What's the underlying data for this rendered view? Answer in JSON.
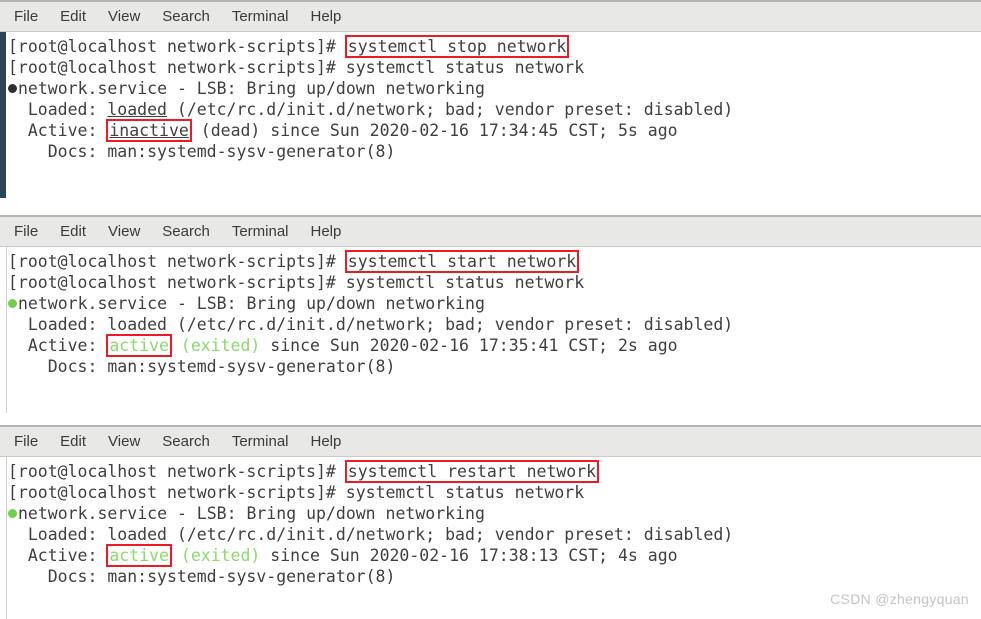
{
  "menu": {
    "items": [
      "File",
      "Edit",
      "View",
      "Search",
      "Terminal",
      "Help"
    ]
  },
  "colors": {
    "accent_red": "#ee1b24",
    "active_green": "#8ada6c",
    "dot_active_green": "#6ed24a",
    "dot_dead": "#2e2e2e",
    "menubar_bg": "#e8e8e6",
    "terminal_bg": "#ffffff",
    "text": "#3f3f3f",
    "left_edge_dark": "#2d4356",
    "watermark": "#c4c4c4"
  },
  "watermark": "CSDN @zhengyquan",
  "terminals": [
    {
      "id": "terminal-stop",
      "left_edge": "dark",
      "prompt": "[root@localhost network-scripts]# ",
      "command_highlighted": "systemctl stop network",
      "prompt2": "[root@localhost network-scripts]# ",
      "command2": "systemctl status network",
      "status_dot": "dead",
      "unit_line": "network.service - LSB: Bring up/down networking",
      "loaded_label": "  Loaded: ",
      "loaded_word": "loaded",
      "loaded_word_underlined": true,
      "loaded_rest": " (/etc/rc.d/init.d/network; bad; vendor preset: disabled)",
      "active_label": "  Active: ",
      "active_word": "inactive",
      "active_word_color": "dark",
      "active_word_underlined": true,
      "active_paren": " (dead)",
      "active_paren_color": "dark",
      "active_rest": " since Sun 2020-02-16 17:34:45 CST; 5s ago",
      "docs_line": "    Docs: man:systemd-sysv-generator(8)"
    },
    {
      "id": "terminal-start",
      "left_edge": "light",
      "prompt": "[root@localhost network-scripts]# ",
      "command_highlighted": "systemctl start network",
      "prompt2": "[root@localhost network-scripts]# ",
      "command2": "systemctl status network",
      "status_dot": "active",
      "unit_line": "network.service - LSB: Bring up/down networking",
      "loaded_label": "  Loaded: ",
      "loaded_word": "loaded",
      "loaded_word_underlined": false,
      "loaded_rest": " (/etc/rc.d/init.d/network; bad; vendor preset: disabled)",
      "active_label": "  Active: ",
      "active_word": "active",
      "active_word_color": "green",
      "active_word_underlined": false,
      "active_paren": " (exited)",
      "active_paren_color": "green",
      "active_rest": " since Sun 2020-02-16 17:35:41 CST; 2s ago",
      "docs_line": "    Docs: man:systemd-sysv-generator(8)"
    },
    {
      "id": "terminal-restart",
      "left_edge": "light",
      "prompt": "[root@localhost network-scripts]# ",
      "command_highlighted": "systemctl restart network",
      "prompt2": "[root@localhost network-scripts]# ",
      "command2": "systemctl status network",
      "status_dot": "active",
      "unit_line": "network.service - LSB: Bring up/down networking",
      "loaded_label": "  Loaded: ",
      "loaded_word": "loaded",
      "loaded_word_underlined": false,
      "loaded_rest": " (/etc/rc.d/init.d/network; bad; vendor preset: disabled)",
      "active_label": "  Active: ",
      "active_word": "active",
      "active_word_color": "green",
      "active_word_underlined": false,
      "active_paren": " (exited)",
      "active_paren_color": "green",
      "active_rest": " since Sun 2020-02-16 17:38:13 CST; 4s ago",
      "docs_line": "    Docs: man:systemd-sysv-generator(8)"
    }
  ]
}
